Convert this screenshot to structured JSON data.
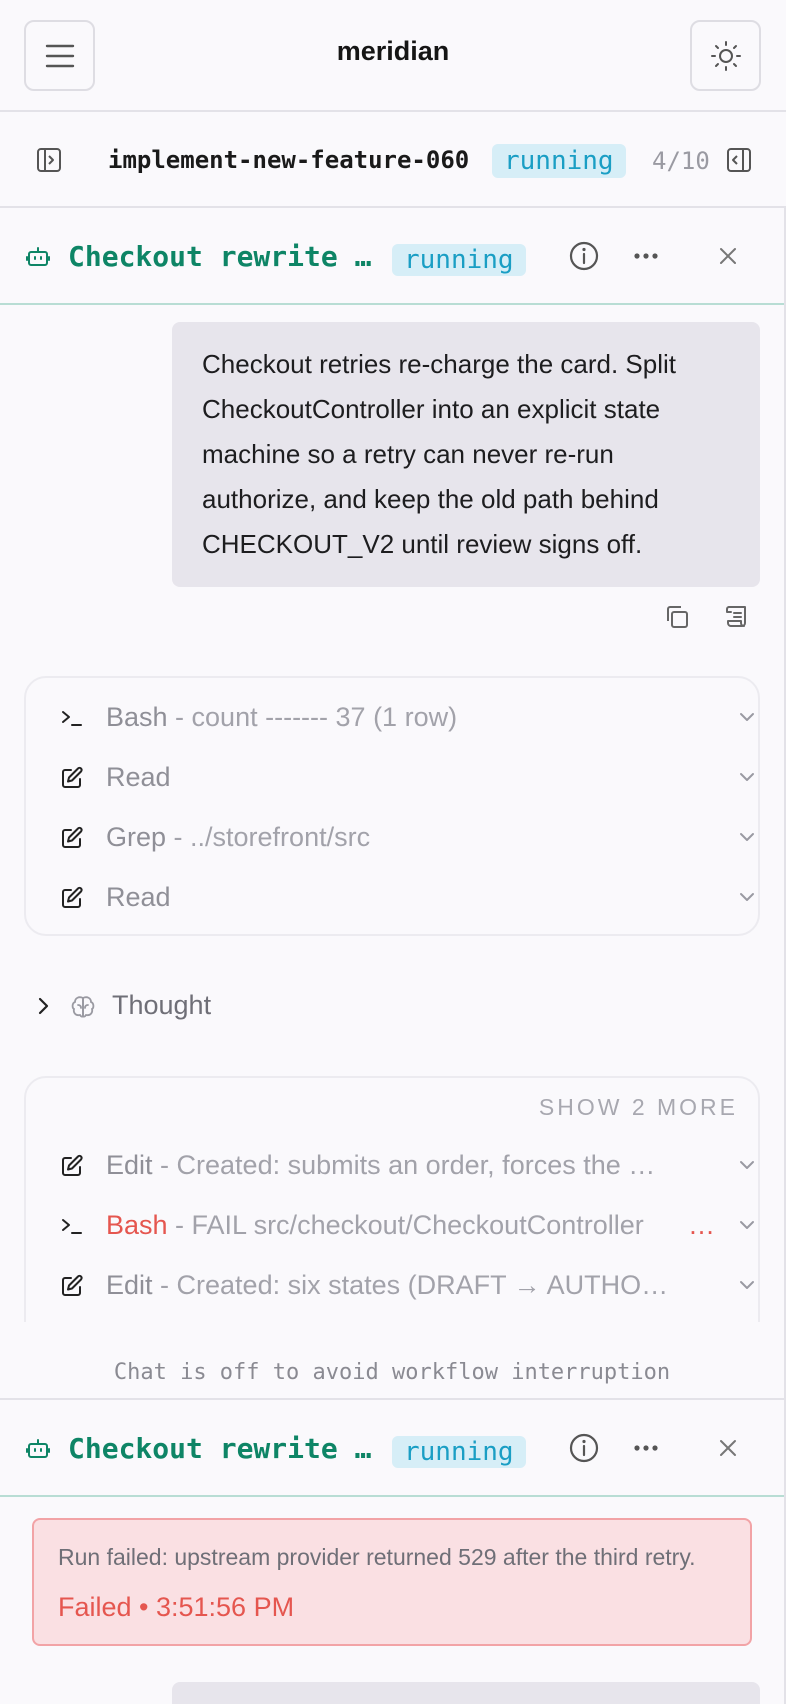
{
  "header": {
    "title": "meridian",
    "menu_icon": "hamburger-menu-icon",
    "theme_icon": "sun-icon"
  },
  "workflow": {
    "name": "implement-new-feature-060",
    "status": "running",
    "progress": "4/10"
  },
  "agent_panels": [
    {
      "title": "Checkout rewrite …",
      "status": "running"
    },
    {
      "title": "Checkout rewrite …",
      "status": "running"
    }
  ],
  "user_message": "Checkout retries re-charge the card. Split CheckoutController into an explicit state machine so a retry can never re-run authorize, and keep the old path behind CHECKOUT_V2 until review signs off.",
  "tool_group_1": [
    {
      "name": "Bash",
      "detail": " - count ------- 37 (1 row)",
      "icon": "terminal-icon"
    },
    {
      "name": "Read",
      "detail": "",
      "icon": "edit-icon"
    },
    {
      "name": "Grep",
      "detail": " - ../storefront/src",
      "icon": "edit-icon"
    },
    {
      "name": "Read",
      "detail": "",
      "icon": "edit-icon"
    }
  ],
  "thought": {
    "label": "Thought"
  },
  "tool_group_2": {
    "show_more": "SHOW 2 MORE",
    "rows": [
      {
        "name": "Edit",
        "detail": " - Created: submits an order, forces the …",
        "icon": "edit-icon",
        "status": "ok"
      },
      {
        "name": "Bash",
        "detail": " - FAIL src/checkout/CheckoutController",
        "icon": "terminal-icon",
        "status": "fail"
      },
      {
        "name": "Edit",
        "detail": " - Created: six states (DRAFT → AUTHO…",
        "icon": "edit-icon",
        "status": "ok"
      }
    ]
  },
  "chat_notice": "Chat is off to avoid workflow interruption",
  "error": {
    "message": "Run failed: upstream provider returned 529 after the third retry.",
    "status": "Failed • 3:51:56 PM"
  },
  "colors": {
    "accent_green": "#0e8566",
    "badge_bg": "#d6eef7",
    "badge_text": "#1a9ec4",
    "error": "#e5564f"
  }
}
